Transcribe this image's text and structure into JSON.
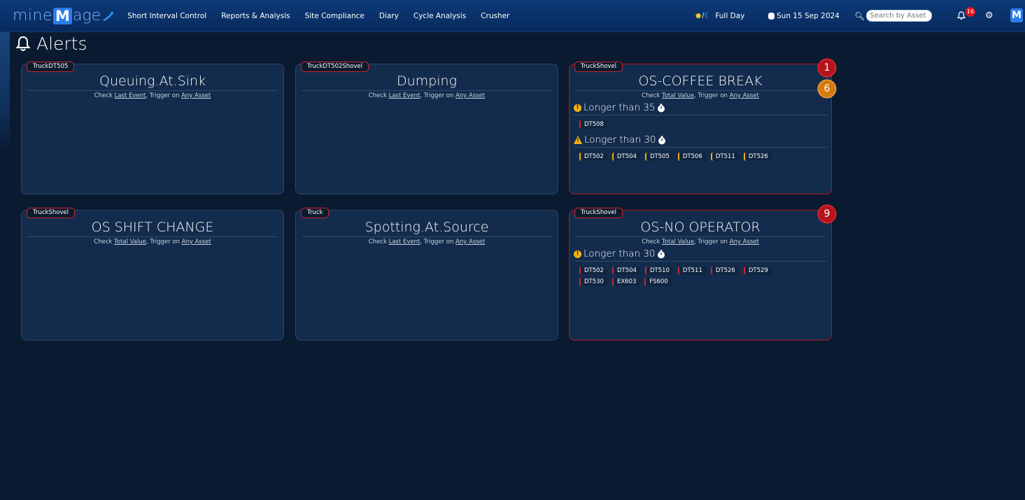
{
  "app": {
    "logo_left": "mine",
    "logo_m": "M",
    "logo_right": "age"
  },
  "nav": {
    "items": [
      "Short Interval Control",
      "Reports & Analysis",
      "Site Compliance",
      "Diary",
      "Cycle Analysis",
      "Crusher"
    ],
    "day_mode": "Full Day",
    "date": "Sun 15 Sep 2024",
    "search_placeholder": "Search by Asset ID...",
    "notification_count": "16"
  },
  "page": {
    "title": "Alerts"
  },
  "cards": [
    {
      "tag": "TruckDT505",
      "title": "Queuing.At.Sink",
      "check": "Last Event",
      "trigger": "Any Asset"
    },
    {
      "tag": "TruckDT502Shovel",
      "title": "Dumping",
      "check": "Last Event",
      "trigger": "Any Asset"
    },
    {
      "tag": "TruckShovel",
      "title": "OS-COFFEE BREAK",
      "check": "Total Value",
      "trigger": "Any Asset",
      "badge_red": "1",
      "badge_orange": "6",
      "sections": [
        {
          "label": "Longer than 35",
          "level": "info",
          "chips": [
            "DT508"
          ]
        },
        {
          "label": "Longer than 30",
          "level": "warning",
          "chips": [
            "DT502",
            "DT504",
            "DT505",
            "DT506",
            "DT511",
            "DT526"
          ]
        }
      ]
    },
    {
      "tag": "TruckShovel",
      "title": "OS SHIFT CHANGE",
      "check": "Total Value",
      "trigger": "Any Asset"
    },
    {
      "tag": "Truck",
      "title": "Spotting.At.Source",
      "check": "Last Event",
      "trigger": "Any Asset"
    },
    {
      "tag": "TruckShovel",
      "title": "OS-NO OPERATOR",
      "check": "Total Value",
      "trigger": "Any Asset",
      "badge_red": "9",
      "sections": [
        {
          "label": "Longer than 30",
          "level": "info",
          "chips": [
            "DT502",
            "DT504",
            "DT510",
            "DT511",
            "DT526",
            "DT529",
            "DT530",
            "EX603",
            "FS600"
          ]
        }
      ]
    }
  ],
  "text": {
    "check_word": "Check",
    "trigger_word": "Trigger on"
  },
  "colors": {
    "accent": "#2b7de9",
    "alert_red": "#b0161c",
    "warn_yellow": "#f5b30d",
    "orange": "#d37a12",
    "background": "#0a1a30"
  }
}
